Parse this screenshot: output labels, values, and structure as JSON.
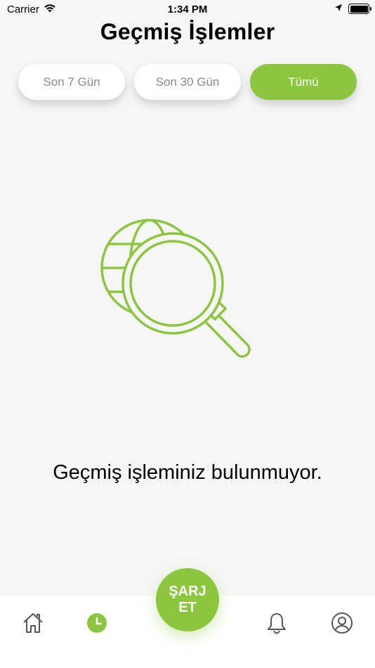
{
  "status_bar": {
    "carrier": "Carrier",
    "time": "1:34 PM"
  },
  "header": {
    "title": "Geçmiş İşlemler"
  },
  "filters": {
    "tabs": [
      {
        "label": "Son 7 Gün",
        "active": false
      },
      {
        "label": "Son 30 Gün",
        "active": false
      },
      {
        "label": "Tümü",
        "active": true
      }
    ]
  },
  "empty_state": {
    "icon": "globe-magnifier-icon",
    "message": "Geçmiş işleminiz bulunmuyor."
  },
  "bottom_nav": {
    "items": [
      {
        "icon": "home-icon",
        "active": false
      },
      {
        "icon": "clock-icon",
        "active": true
      },
      {
        "icon": "bell-icon",
        "active": false
      },
      {
        "icon": "profile-icon",
        "active": false
      }
    ],
    "charge_label": "ŞARJ ET"
  },
  "colors": {
    "accent": "#8cc63f",
    "background": "#f6f6f6",
    "tab_text": "#8a8a8a",
    "icon_gray": "#555555"
  }
}
